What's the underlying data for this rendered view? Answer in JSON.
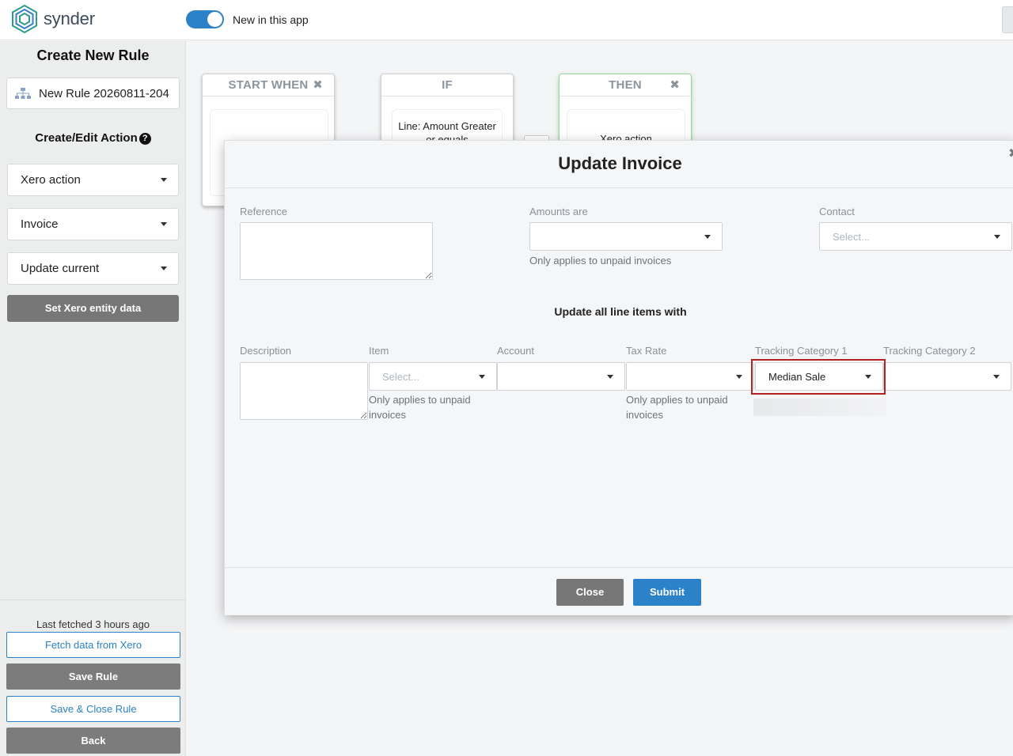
{
  "app": {
    "logo_text": "synder",
    "toggle_label": "New in this app",
    "toggle_on": true,
    "accent_color": "#2c82c9"
  },
  "sidebar": {
    "title": "Create New Rule",
    "rule_name_value": "New Rule 20260811-204",
    "rule_icon": "sitemap-icon",
    "section_title": "Create/Edit Action",
    "selects": [
      {
        "value": "Xero action"
      },
      {
        "value": "Invoice"
      },
      {
        "value": "Update current"
      }
    ],
    "set_entity_button": "Set Xero entity data",
    "last_fetched": "Last fetched 3 hours ago",
    "fetch_button": "Fetch data from Xero",
    "save_button": "Save Rule",
    "save_close_button": "Save & Close Rule",
    "back_button": "Back"
  },
  "canvas": {
    "cards": [
      {
        "title": "START WHEN",
        "close_icon": "close-icon",
        "body": ""
      },
      {
        "title": "IF",
        "body": "Line: Amount Greater or equals"
      },
      {
        "title": "THEN",
        "close_icon": "close-icon",
        "body": "Xero action"
      }
    ]
  },
  "modal": {
    "title": "Update Invoice",
    "reference_label": "Reference",
    "amounts_label": "Amounts are",
    "amounts_value": "",
    "amounts_note": "Only applies to unpaid invoices",
    "contact_label": "Contact",
    "contact_placeholder": "Select...",
    "section_title": "Update all line items with",
    "columns": {
      "description": "Description",
      "item": "Item",
      "account": "Account",
      "tax_rate": "Tax Rate",
      "tracking1": "Tracking Category 1",
      "tracking2": "Tracking Category 2"
    },
    "item_placeholder": "Select...",
    "item_note": "Only applies to unpaid invoices",
    "account_value": "",
    "tax_rate_value": "",
    "tax_note": "Only applies to unpaid invoices",
    "tracking1_value": "Median Sale",
    "tracking2_value": "",
    "close_button": "Close",
    "submit_button": "Submit",
    "highlight_color": "#b22222"
  }
}
